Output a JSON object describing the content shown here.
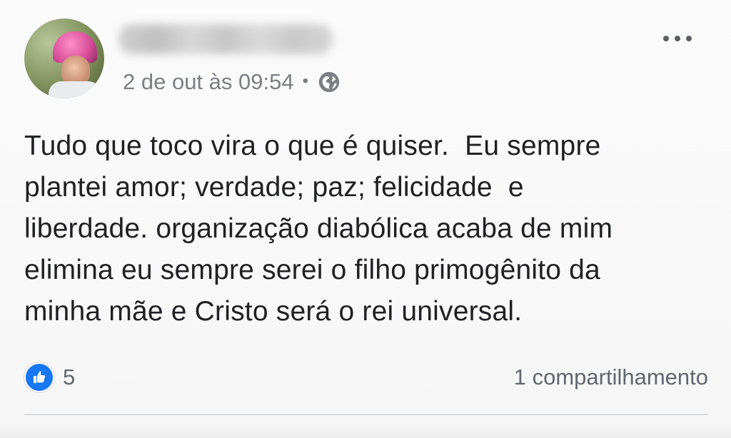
{
  "post": {
    "author_name": "",
    "timestamp": "2 de out às 09:54",
    "separator": "•",
    "privacy_icon": "globe-icon",
    "menu_icon": "more-options-icon",
    "text": "Tudo que toco vira o que é quiser.  Eu sempre\nplantei amor; verdade; paz; felicidade  e\nliberdade. organização diabólica acaba de mim\nelimina eu sempre serei o filho primogênito da\nminha mãe e Cristo será o rei universal.",
    "likes_count": "5",
    "reaction_icon": "thumbs-up-icon",
    "shares_text": "1 compartilhamento"
  },
  "colors": {
    "accent": "#1877f2",
    "meta_text": "#7b7f84",
    "body_text": "#202124",
    "divider": "#dadde1"
  }
}
